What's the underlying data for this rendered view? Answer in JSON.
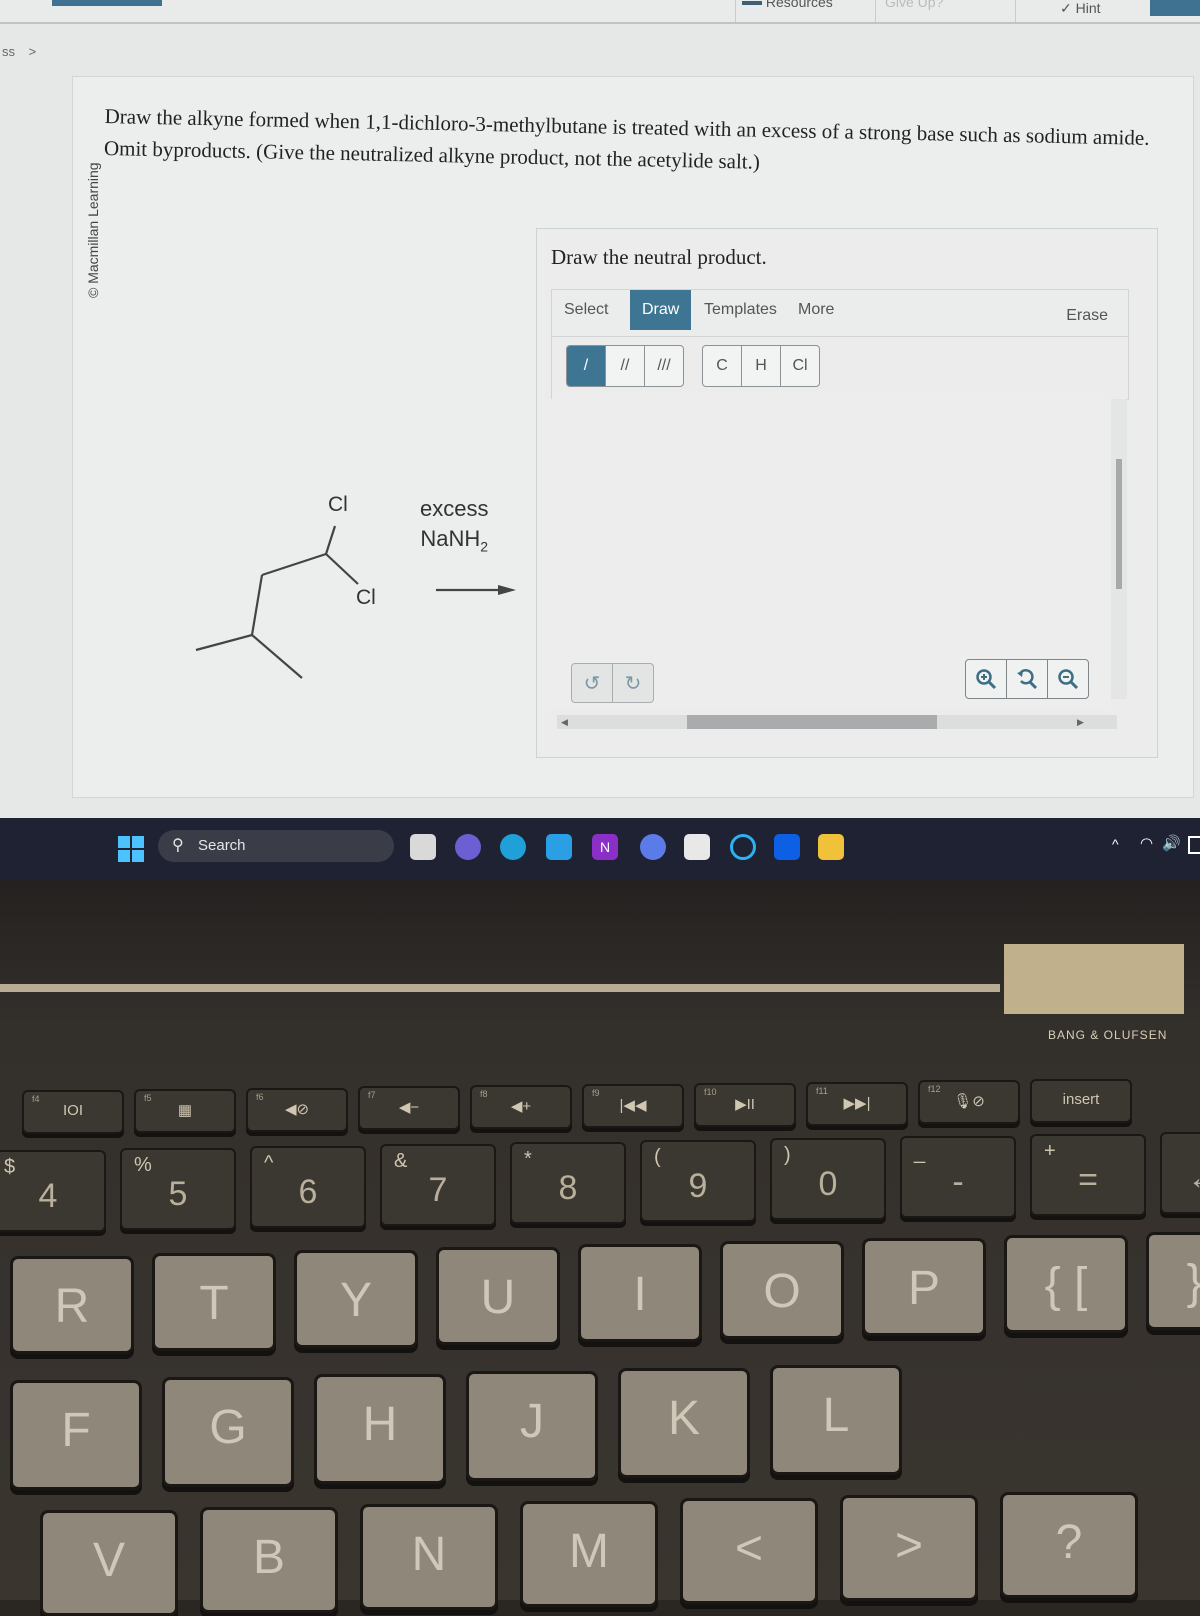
{
  "topbar": {
    "resources_label": "Resources",
    "give_up_label": "Give Up?",
    "hint_label": "Hint"
  },
  "breadcrumb": {
    "text": "ss",
    "chevron": ">"
  },
  "credit": "© Macmillan Learning",
  "question": {
    "line1": "Draw the alkyne formed when 1,1-dichloro-3-methylbutane is treated with an excess of a strong base such as sodium amide.",
    "line2": "Omit byproducts. (Give the neutralized alkyne product, not the acetylide salt.)"
  },
  "reaction": {
    "substituent_1": "Cl",
    "substituent_2": "Cl",
    "reagent_line1": "excess",
    "reagent_main": "NaNH",
    "reagent_sub": "2"
  },
  "editor": {
    "title": "Draw the neutral product.",
    "tabs": [
      {
        "label": "Select",
        "active": false
      },
      {
        "label": "Draw",
        "active": true
      },
      {
        "label": "Templates",
        "active": false
      },
      {
        "label": "More",
        "active": false
      }
    ],
    "erase_label": "Erase",
    "bond_tools": [
      {
        "name": "single-bond",
        "glyph": "/",
        "active": true
      },
      {
        "name": "double-bond",
        "glyph": "//",
        "active": false
      },
      {
        "name": "triple-bond",
        "glyph": "///",
        "active": false
      }
    ],
    "atom_tools": [
      "C",
      "H",
      "Cl"
    ],
    "undo_icon": "undo-icon",
    "redo_icon": "redo-icon",
    "zoom_in_icon": "zoom-in-icon",
    "zoom_reset_icon": "zoom-reset-icon",
    "zoom_out_icon": "zoom-out-icon"
  },
  "taskbar": {
    "search_placeholder": "Search",
    "apps": [
      "task-view",
      "teams",
      "edge",
      "mail",
      "onenote",
      "copilot",
      "store",
      "cortana",
      "dropbox",
      "file-explorer"
    ],
    "tray": [
      "chevron-up",
      "wifi",
      "volume",
      "battery"
    ]
  },
  "keyboard": {
    "brand": "BANG & OLUFSEN",
    "fn_row": [
      {
        "fn": "f4",
        "glyph": "IOI"
      },
      {
        "fn": "f5",
        "glyph": "▦"
      },
      {
        "fn": "f6",
        "glyph": "◀⊘"
      },
      {
        "fn": "f7",
        "glyph": "◀−"
      },
      {
        "fn": "f8",
        "glyph": "◀+"
      },
      {
        "fn": "f9",
        "glyph": "|◀◀"
      },
      {
        "fn": "f10",
        "glyph": "▶II"
      },
      {
        "fn": "f11",
        "glyph": "▶▶|"
      },
      {
        "fn": "f12",
        "glyph": "🎙⊘"
      },
      {
        "fn": "",
        "glyph": "insert"
      }
    ],
    "num_row": [
      {
        "top": "$",
        "main": "4"
      },
      {
        "top": "%",
        "main": "5"
      },
      {
        "top": "^",
        "main": "6"
      },
      {
        "top": "&",
        "main": "7"
      },
      {
        "top": "*",
        "main": "8"
      },
      {
        "top": "(",
        "main": "9"
      },
      {
        "top": ")",
        "main": "0"
      },
      {
        "top": "_",
        "main": "-"
      },
      {
        "top": "+",
        "main": "="
      },
      {
        "top": "",
        "main": "← b"
      }
    ],
    "row_q": [
      "R",
      "T",
      "Y",
      "U",
      "I",
      "O",
      "P",
      "{ [",
      "} ]"
    ],
    "row_a": [
      "F",
      "G",
      "H",
      "J",
      "K",
      "L"
    ],
    "row_z": [
      "V",
      "B",
      "N",
      "M",
      "<",
      ">",
      "?"
    ]
  }
}
